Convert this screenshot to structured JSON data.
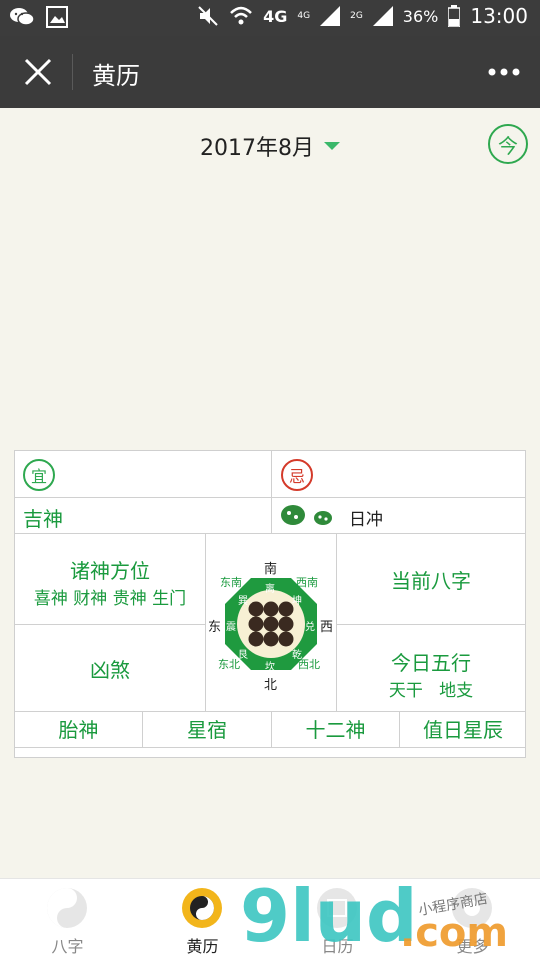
{
  "status": {
    "network": "4G",
    "sig1": "4G",
    "sig2": "2G",
    "battery": "36%",
    "time": "13:00"
  },
  "appbar": {
    "title": "黄历"
  },
  "month": {
    "label": "2017年8月",
    "today_label": "今"
  },
  "table": {
    "yi": "宜",
    "ji": "忌",
    "jishen": "吉神",
    "richong": "日冲",
    "zhushen": "诸神方位",
    "zhushen_sub": "喜神 财神 贵神 生门",
    "xiongsha": "凶煞",
    "bazi": "当前八字",
    "wuxing": "今日五行",
    "wuxing_sub": "天干   地支",
    "taishen": "胎神",
    "xingxiu": "星宿",
    "shiershen": "十二神",
    "zhirixingchen": "值日星辰",
    "compass": {
      "south": "南",
      "north": "北",
      "east": "东",
      "west": "西",
      "se": "东南",
      "sw": "西南",
      "ne": "东北",
      "nw": "西北",
      "trigrams": [
        "离",
        "坤",
        "兑",
        "乾",
        "坎",
        "艮",
        "震",
        "巽"
      ]
    }
  },
  "tabs": [
    {
      "label": "八字",
      "icon": "bazi-icon"
    },
    {
      "label": "黄历",
      "icon": "yinyang-icon"
    },
    {
      "label": "日历",
      "icon": "calendar-icon"
    },
    {
      "label": "更多",
      "icon": "more-icon"
    }
  ],
  "watermark": {
    "text": "9lud",
    "sub": ".com",
    "tag": "小程序商店"
  },
  "colors": {
    "accent": "#2ea84f",
    "bar": "#3b3b3b",
    "ji_red": "#d43a2a"
  }
}
